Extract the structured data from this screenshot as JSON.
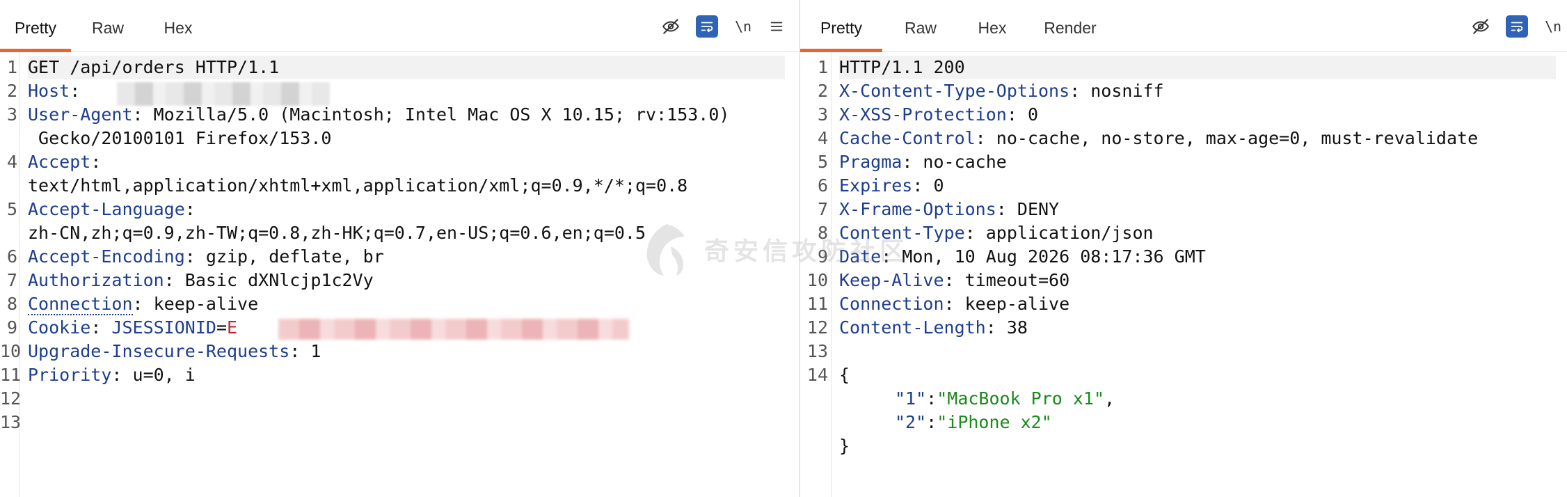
{
  "request": {
    "tabs": [
      {
        "label": "Pretty",
        "active": true
      },
      {
        "label": "Raw",
        "active": false
      },
      {
        "label": "Hex",
        "active": false
      }
    ],
    "tools": {
      "newline_label": "\\n"
    },
    "line_numbers": [
      "1",
      "2",
      "3",
      "",
      "4",
      "",
      "5",
      "",
      "6",
      "7",
      "8",
      "9",
      "10",
      "11",
      "12",
      "13"
    ],
    "lines": {
      "l1": "GET /api/orders HTTP/1.1",
      "l2_key": "Host",
      "l2_sep": ": ",
      "l3_key": "User-Agent",
      "l3_sep": ": ",
      "l3_val": "Mozilla/5.0 (Macintosh; Intel Mac OS X 10.15; rv:153.0)",
      "l3_cont": " Gecko/20100101 Firefox/153.0",
      "l4_key": "Accept",
      "l4_sep": ":",
      "l4_cont": "text/html,application/xhtml+xml,application/xml;q=0.9,*/*;q=0.8",
      "l5_key": "Accept-Language",
      "l5_sep": ":",
      "l5_cont": "zh-CN,zh;q=0.9,zh-TW;q=0.8,zh-HK;q=0.7,en-US;q=0.6,en;q=0.5",
      "l6_key": "Accept-Encoding",
      "l6_sep": ": ",
      "l6_val": "gzip, deflate, br",
      "l7_key": "Authorization",
      "l7_sep": ": ",
      "l7_val": "Basic dXNlcjp1c2Vy",
      "l8_key": "Connection",
      "l8_sep": ": ",
      "l8_val": "keep-alive",
      "l9_key": "Cookie",
      "l9_sep": ": ",
      "l9_cookie_name": "JSESSIONID",
      "l9_eq": "=",
      "l9_cookie_val": "E",
      "l10_key": "Upgrade-Insecure-Requests",
      "l10_sep": ": ",
      "l10_val": "1",
      "l11_key": "Priority",
      "l11_sep": ": ",
      "l11_val": "u=0, i"
    }
  },
  "response": {
    "tabs": [
      {
        "label": "Pretty",
        "active": true
      },
      {
        "label": "Raw",
        "active": false
      },
      {
        "label": "Hex",
        "active": false
      },
      {
        "label": "Render",
        "active": false
      }
    ],
    "tools": {
      "newline_label": "\\n"
    },
    "line_numbers": [
      "1",
      "2",
      "3",
      "4",
      "5",
      "6",
      "7",
      "8",
      "9",
      "10",
      "11",
      "12",
      "13",
      "14",
      "",
      "",
      ""
    ],
    "lines": {
      "l1": "HTTP/1.1 200",
      "l2_key": "X-Content-Type-Options",
      "l2_val": "nosniff",
      "l3_key": "X-XSS-Protection",
      "l3_val": "0",
      "l4_key": "Cache-Control",
      "l4_val": "no-cache, no-store, max-age=0, must-revalidate",
      "l5_key": "Pragma",
      "l5_val": "no-cache",
      "l6_key": "Expires",
      "l6_val": "0",
      "l7_key": "X-Frame-Options",
      "l7_val": "DENY",
      "l8_key": "Content-Type",
      "l8_val": "application/json",
      "l9_key": "Date",
      "l9_val": "Mon, 10 Aug 2026 08:17:36 GMT",
      "l10_key": "Keep-Alive",
      "l10_val": "timeout=60",
      "l11_key": "Connection",
      "l11_val": "keep-alive",
      "l12_key": "Content-Length",
      "l12_val": "38",
      "sep": ": ",
      "l14": "{",
      "j1_key": "\"1\"",
      "j1_colon": ":",
      "j1_val": "\"MacBook Pro x1\"",
      "j1_comma": ",",
      "j2_key": "\"2\"",
      "j2_colon": ":",
      "j2_val": "\"iPhone x2\"",
      "close": "}"
    }
  },
  "watermark": {
    "text": "奇安信攻防社区"
  },
  "colors": {
    "accent": "#e8652f",
    "header_key": "#1d3d8f",
    "cookie_value": "#c0262d",
    "json_string": "#1a8a1a",
    "active_tool": "#2f63b8"
  }
}
